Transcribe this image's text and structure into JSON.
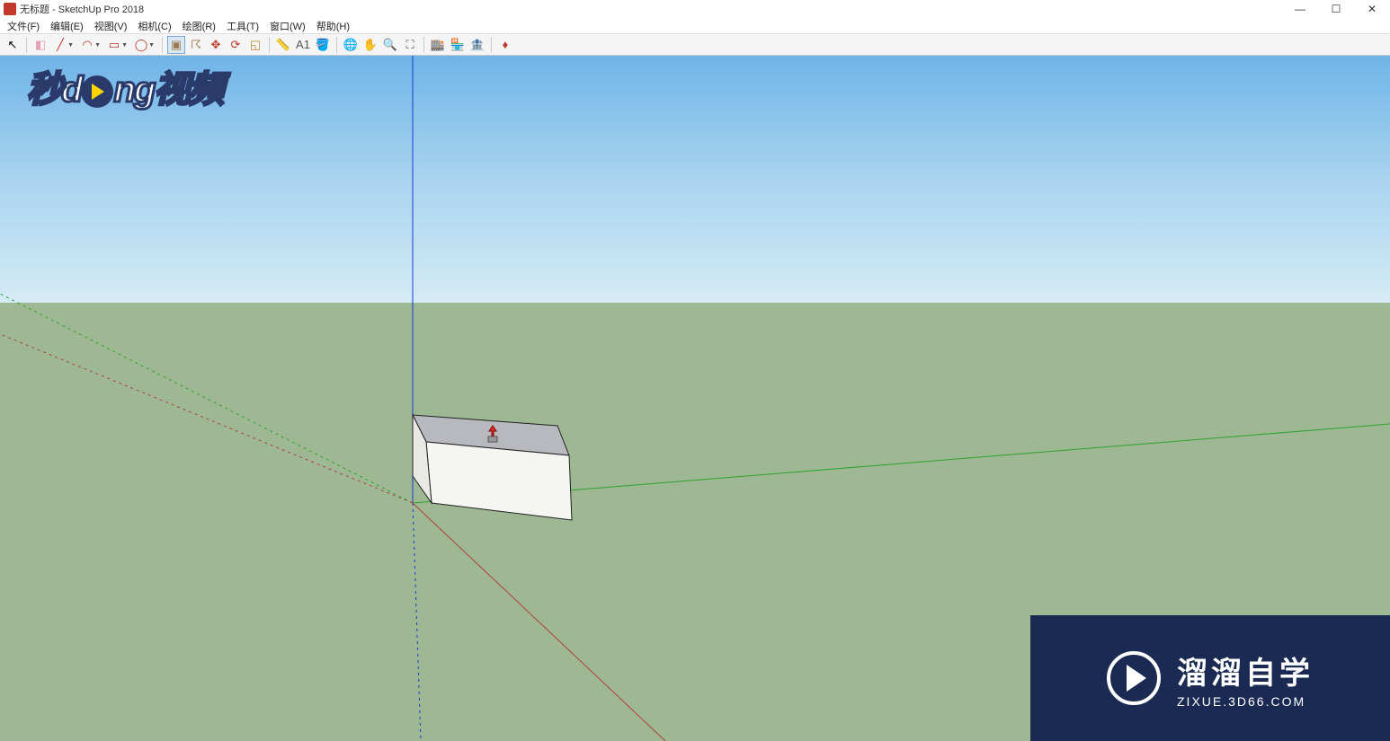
{
  "window": {
    "title": "无标题 - SketchUp Pro 2018",
    "controls": {
      "min": "—",
      "max": "☐",
      "close": "✕"
    }
  },
  "menu": {
    "items": [
      "文件(F)",
      "编辑(E)",
      "视图(V)",
      "相机(C)",
      "绘图(R)",
      "工具(T)",
      "窗口(W)",
      "帮助(H)"
    ]
  },
  "toolbar": {
    "tools": [
      {
        "name": "select",
        "glyph": "↖",
        "color": "#000",
        "dd": false
      },
      {
        "name": "divider"
      },
      {
        "name": "eraser",
        "glyph": "◧",
        "color": "#e79fb4",
        "dd": false
      },
      {
        "name": "line",
        "glyph": "╱",
        "color": "#c0392b",
        "dd": true
      },
      {
        "name": "arc",
        "glyph": "◠",
        "color": "#c0392b",
        "dd": true
      },
      {
        "name": "rectangle",
        "glyph": "▭",
        "color": "#c0392b",
        "dd": true
      },
      {
        "name": "circle",
        "glyph": "◯",
        "color": "#c0392b",
        "dd": true
      },
      {
        "name": "divider"
      },
      {
        "name": "push-pull",
        "glyph": "▣",
        "color": "#9b7b54",
        "dd": false,
        "active": true
      },
      {
        "name": "offset",
        "glyph": "☈",
        "color": "#9b7b54",
        "dd": false
      },
      {
        "name": "move",
        "glyph": "✥",
        "color": "#c0392b",
        "dd": false
      },
      {
        "name": "rotate",
        "glyph": "⟳",
        "color": "#c0392b",
        "dd": false
      },
      {
        "name": "scale",
        "glyph": "◱",
        "color": "#b08830",
        "dd": false
      },
      {
        "name": "divider"
      },
      {
        "name": "tape",
        "glyph": "📏",
        "color": "#c9a227",
        "dd": false
      },
      {
        "name": "text",
        "glyph": "A1",
        "color": "#555",
        "dd": false
      },
      {
        "name": "paint",
        "glyph": "🪣",
        "color": "#c9a227",
        "dd": false
      },
      {
        "name": "divider"
      },
      {
        "name": "orbit",
        "glyph": "🌐",
        "color": "#2a7",
        "dd": false
      },
      {
        "name": "pan",
        "glyph": "✋",
        "color": "#c9a227",
        "dd": false
      },
      {
        "name": "zoom",
        "glyph": "🔍",
        "color": "#555",
        "dd": false
      },
      {
        "name": "zoom-extents",
        "glyph": "⛶",
        "color": "#555",
        "dd": false
      },
      {
        "name": "divider"
      },
      {
        "name": "warehouse-1",
        "glyph": "🏬",
        "color": "#a33",
        "dd": false
      },
      {
        "name": "warehouse-2",
        "glyph": "🏪",
        "color": "#a33",
        "dd": false
      },
      {
        "name": "warehouse-3",
        "glyph": "🏦",
        "color": "#a33",
        "dd": false
      },
      {
        "name": "divider"
      },
      {
        "name": "extension",
        "glyph": "♦",
        "color": "#c0392b",
        "dd": false
      }
    ]
  },
  "watermarks": {
    "top_left_prefix": "秒d",
    "top_left_suffix": "ng视频",
    "bottom_right_title": "溜溜自学",
    "bottom_right_url": "ZIXUE.3D66.COM"
  }
}
